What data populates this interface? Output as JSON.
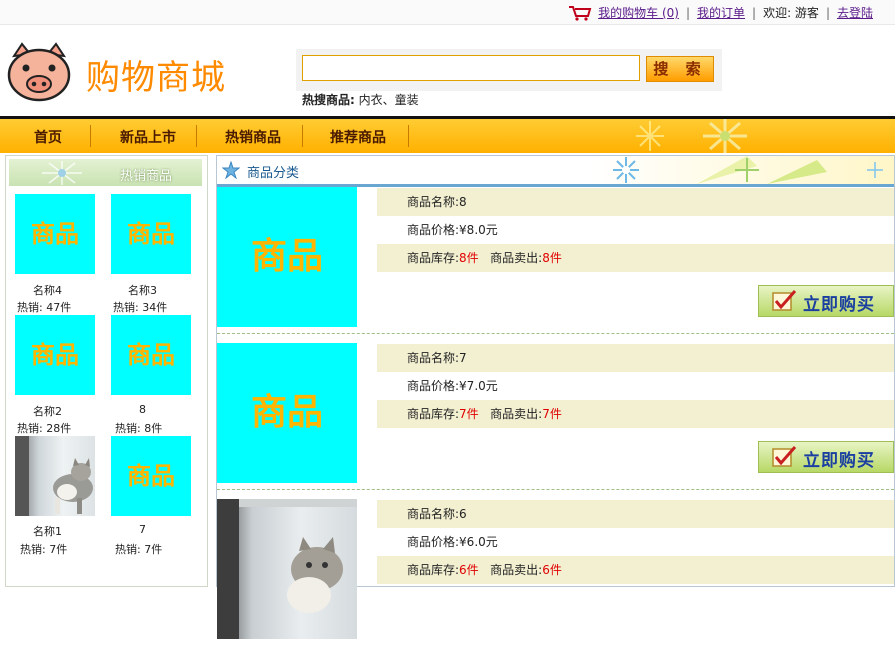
{
  "topbar": {
    "cart_link": "我的购物车 (0)",
    "orders_link": "我的订单",
    "welcome": "欢迎: 游客",
    "login_link": "去登陆",
    "separator": "|"
  },
  "header": {
    "brand": "购物商城",
    "search_placeholder": "",
    "search_button": "搜 索",
    "hot_label": "热搜商品:",
    "hot_keywords": "内衣、童装"
  },
  "nav": {
    "items": [
      "首页",
      "新品上市",
      "热销商品",
      "推荐商品"
    ]
  },
  "sidebar": {
    "title": "热销商品",
    "items": [
      {
        "name": "名称4",
        "sales": "热销: 47件",
        "thumb_text": "商品"
      },
      {
        "name": "名称3",
        "sales": "热销: 34件",
        "thumb_text": "商品"
      },
      {
        "name": "名称2",
        "sales": "热销: 28件",
        "thumb_text": "商品"
      },
      {
        "name": "8",
        "sales": "热销: 8件",
        "thumb_text": "商品"
      },
      {
        "name": "名称1",
        "sales": "热销: 7件",
        "thumb_text": ""
      },
      {
        "name": "7",
        "sales": "热销: 7件",
        "thumb_text": "商品"
      }
    ]
  },
  "main": {
    "title": "商品分类",
    "name_label": "商品名称:",
    "price_label": "商品价格:",
    "stock_label": "商品库存:",
    "sold_label": "商品卖出:",
    "buy_label": "立即购买",
    "products": [
      {
        "image_text": "商品",
        "name": "8",
        "price": "¥8.0元",
        "stock": "8件",
        "sold": "8件"
      },
      {
        "image_text": "商品",
        "name": "7",
        "price": "¥7.0元",
        "stock": "7件",
        "sold": "7件"
      },
      {
        "image_text": "",
        "name": "6",
        "price": "¥6.0元",
        "stock": "6件",
        "sold": "6件"
      }
    ]
  },
  "colors": {
    "brand": "#ff8a00",
    "nav_bg": "#ffb000",
    "placeholder_bg": "#00ffff",
    "placeholder_text": "#ffb400",
    "price_red": "#e00000"
  },
  "icons": {
    "cart": "shopping-cart-icon",
    "logo": "pig-logo-icon",
    "star": "star-icon",
    "buy": "checkmark-icon"
  }
}
